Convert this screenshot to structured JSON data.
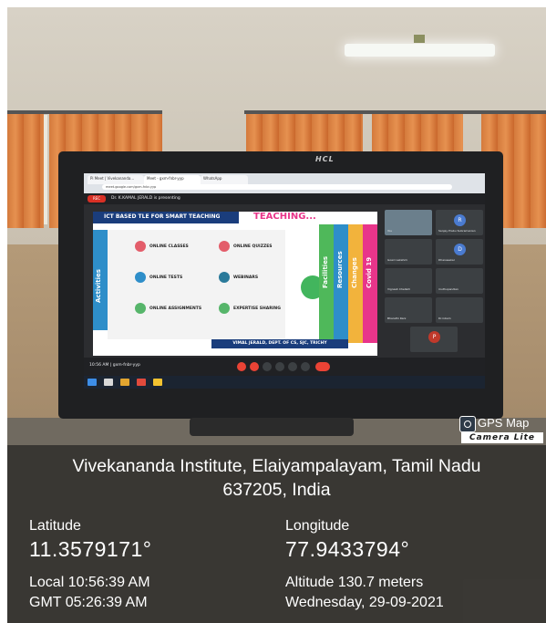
{
  "photo": {
    "description_icon": "classroom-monitor-photo",
    "monitor_brand": "HCL",
    "screen": {
      "browser_tab_1": "Pi Meet | Vivekananda...",
      "browser_tab_2": "Meet - gxm-fnbr-yyp",
      "browser_tab_3": "WhatsApp",
      "address": "meet.google.com/gxm-fnbr-yyp",
      "rec_label": "REC",
      "presenting_text": "Dr. K.KAMAL JERALD is presenting",
      "slide": {
        "title": "ICT BASED TLE FOR SMART TEACHING",
        "heading": "TEACHING...",
        "side_label": "Activities",
        "items": [
          "ONLINE CLASSES",
          "ONLINE QUIZZES",
          "ONLINE TESTS",
          "WEBINARS",
          "ONLINE ASSIGNMENTS",
          "EXPERTISE SHARING"
        ],
        "pillars": [
          "Facilities",
          "Resources",
          "Changes",
          "Covid 19"
        ],
        "footer": "VIMAL JERALD, DEPT. OF CS, SJC, TRICHY"
      },
      "participants": [
        "Sanjay Prabu Subramanian",
        "Gowri Lakshmi",
        "Dhanasekar",
        "Vignesh Chellaih",
        "muthupandian",
        "Bharathi Rani",
        "Dr.inbam",
        "You"
      ],
      "avatar_letters": [
        "R",
        "D",
        "P"
      ],
      "meeting_code": "10:56 AM | gxm-fnbr-yyp"
    }
  },
  "watermark": {
    "icon": "camera-icon",
    "title": "GPS Map",
    "subtitle": "Camera Lite"
  },
  "location": {
    "address_line_1": "Vivekananda Institute, Elaiyampalayam, Tamil Nadu",
    "address_line_2": "637205, India",
    "latitude_label": "Latitude",
    "latitude_value": "11.3579171°",
    "longitude_label": "Longitude",
    "longitude_value": "77.9433794°",
    "local_time": "Local 10:56:39 AM",
    "gmt_time": "GMT 05:26:39 AM",
    "altitude": "Altitude 130.7 meters",
    "date": "Wednesday, 29-09-2021"
  },
  "colors": {
    "overlay": "#191919",
    "text": "#ffffff",
    "curtain": "#d47a3c",
    "slide_accent": "#1a3d7c",
    "teaching_pink": "#e8358a"
  }
}
